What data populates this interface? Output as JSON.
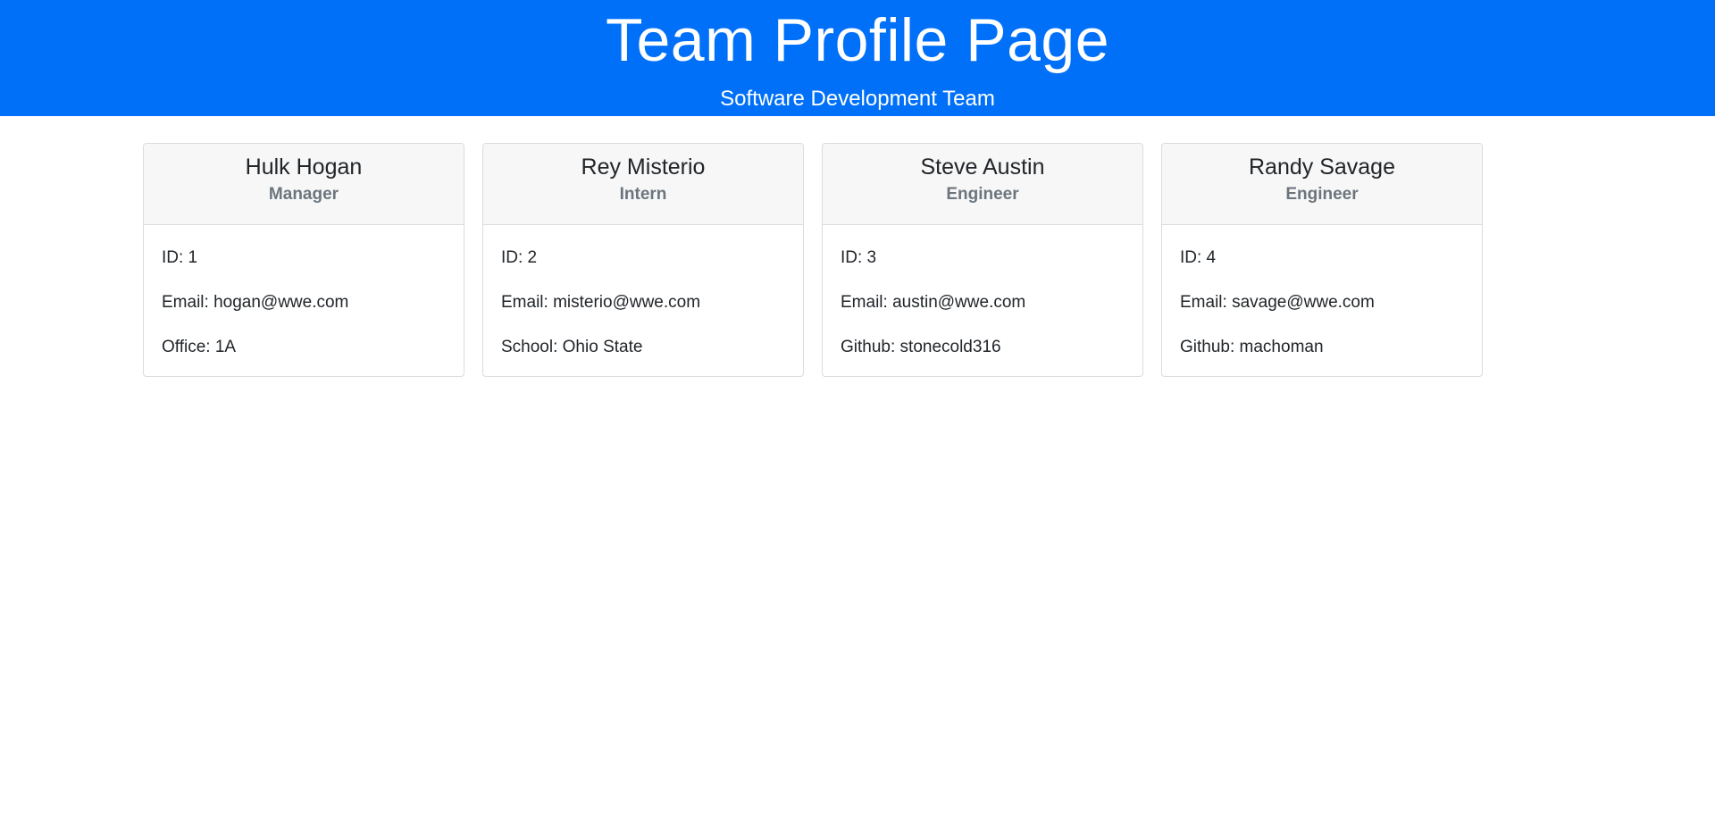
{
  "header": {
    "title": "Team Profile Page",
    "subtitle": "Software Development Team",
    "background_color": "#0070f8"
  },
  "team": [
    {
      "name": "Hulk Hogan",
      "role": "Manager",
      "id_line": "ID: 1",
      "email_line": "Email: hogan@wwe.com",
      "extra_line": "Office: 1A"
    },
    {
      "name": "Rey Misterio",
      "role": "Intern",
      "id_line": "ID: 2",
      "email_line": "Email: misterio@wwe.com",
      "extra_line": "School: Ohio State"
    },
    {
      "name": "Steve Austin",
      "role": "Engineer",
      "id_line": "ID: 3",
      "email_line": "Email: austin@wwe.com",
      "extra_line": "Github: stonecold316"
    },
    {
      "name": "Randy Savage",
      "role": "Engineer",
      "id_line": "ID: 4",
      "email_line": "Email: savage@wwe.com",
      "extra_line": "Github: machoman"
    }
  ]
}
